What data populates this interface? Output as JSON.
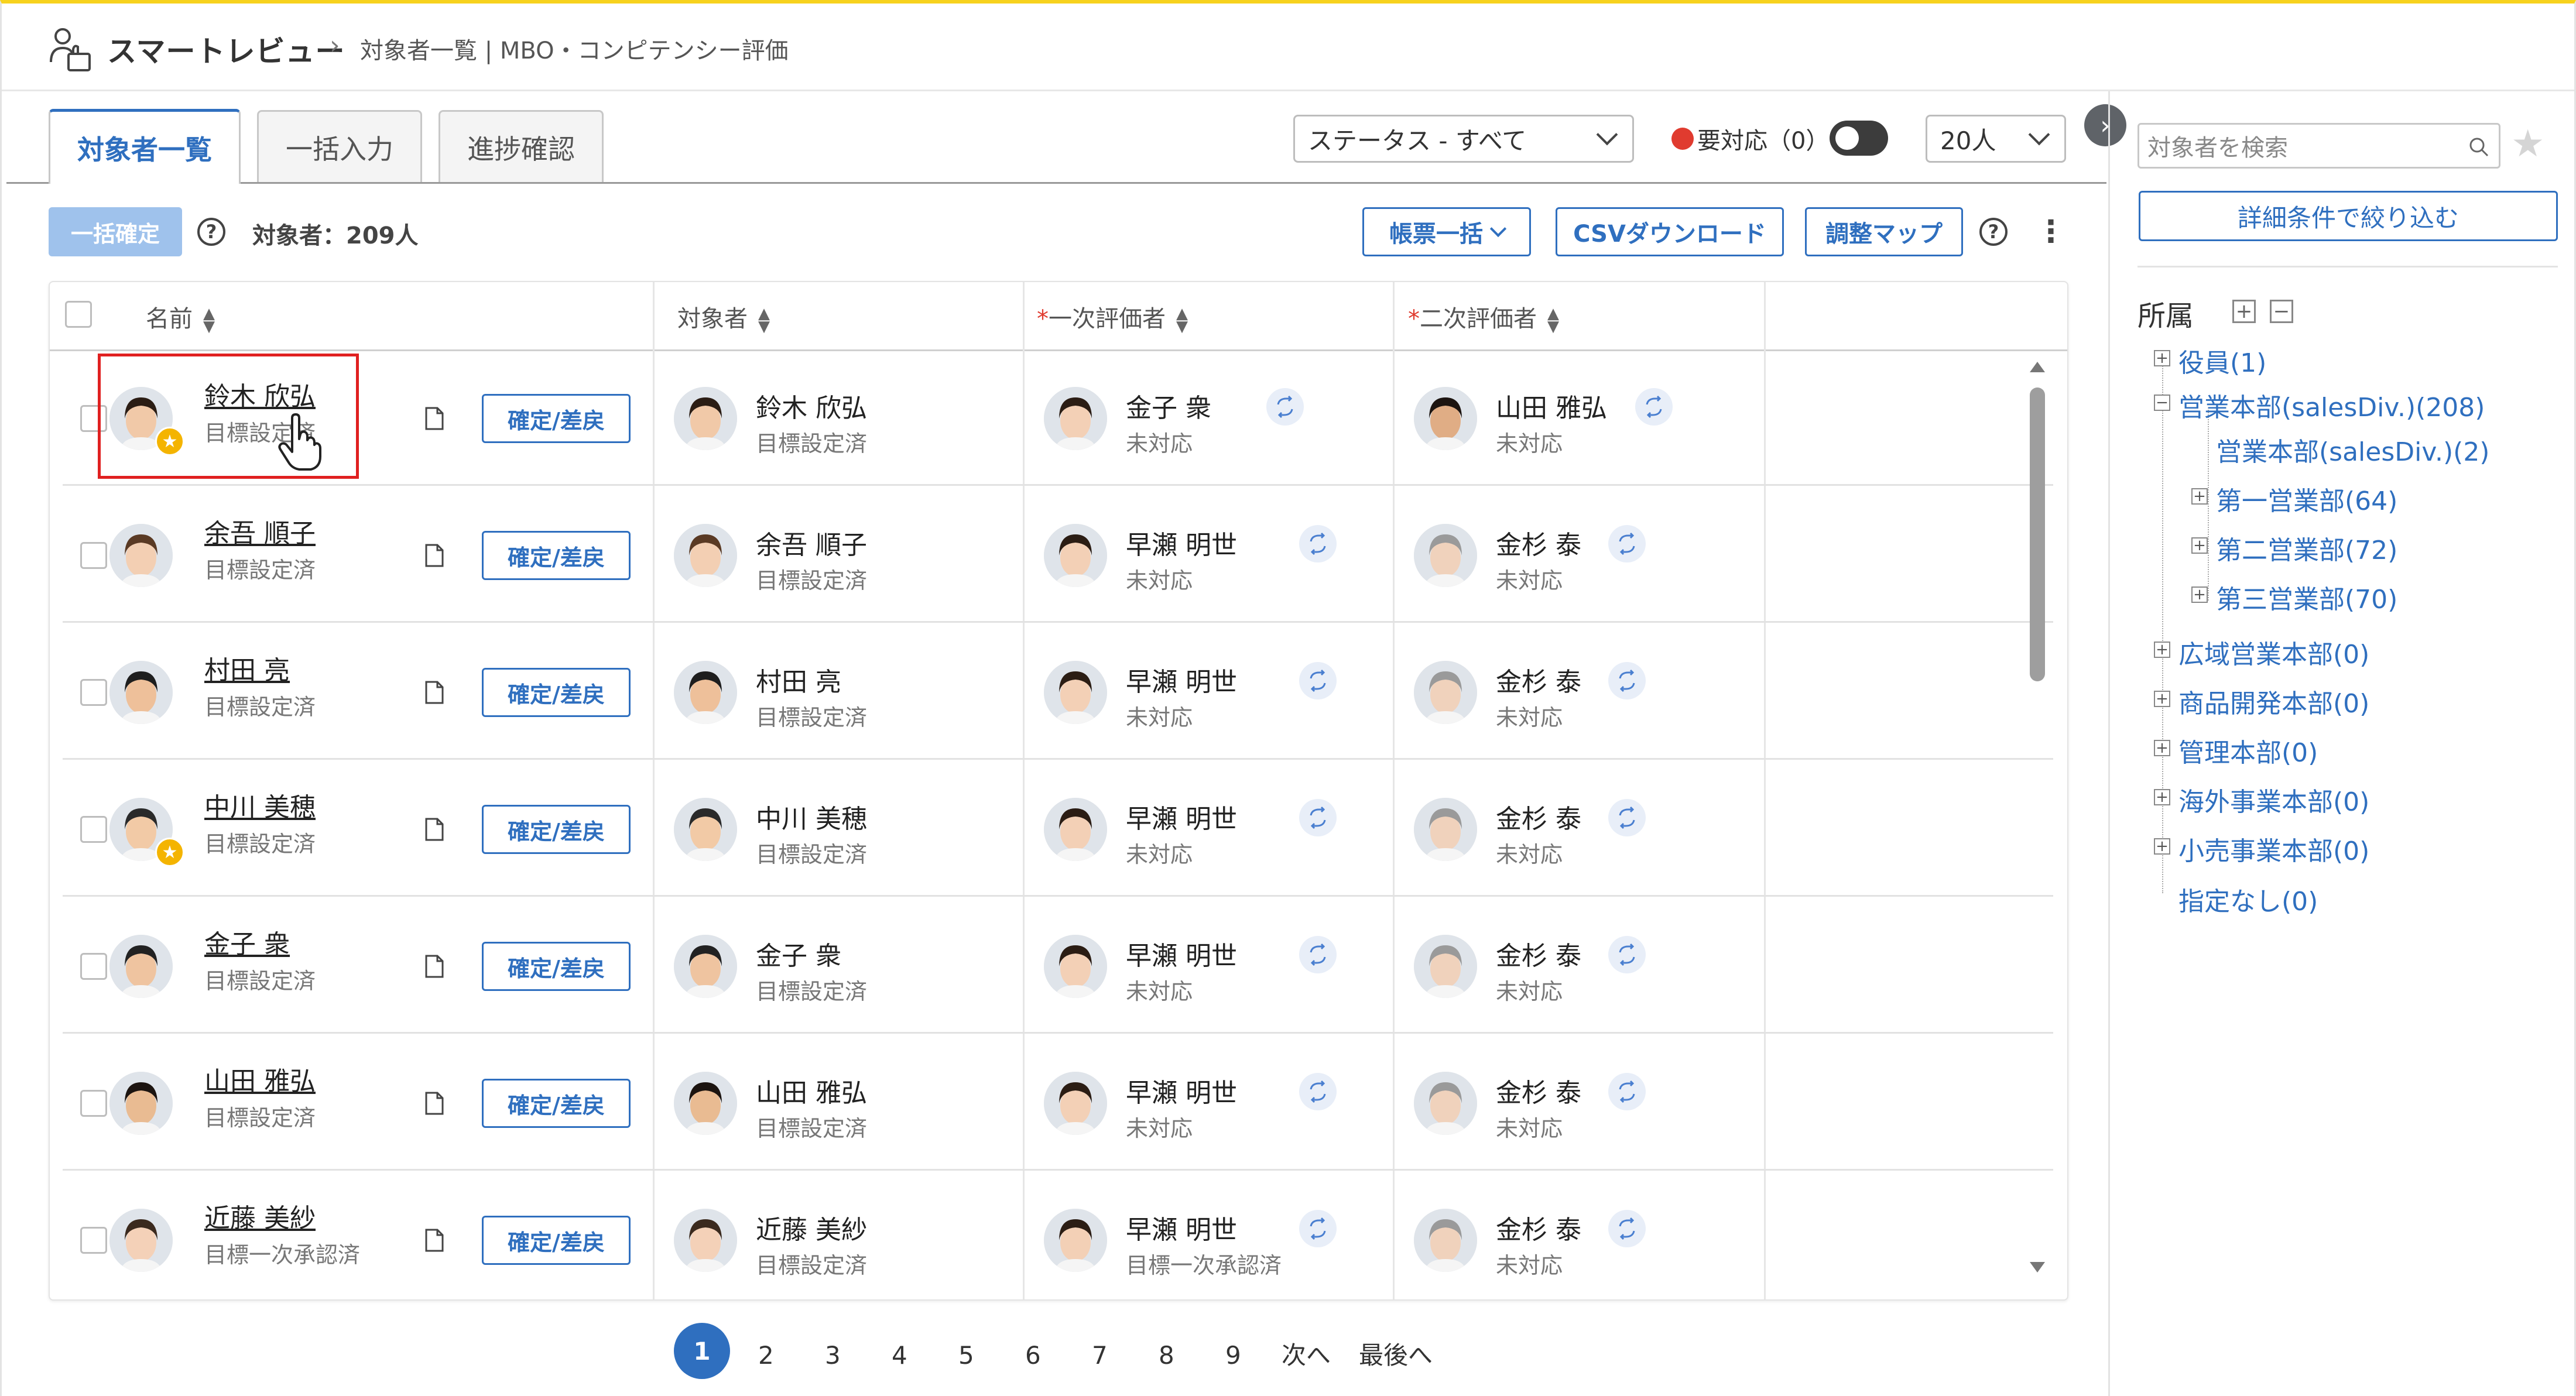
{
  "header": {
    "app_title": "スマートレビュー",
    "breadcrumb": "対象者一覧 | MBO・コンピテンシー評価"
  },
  "tabs": [
    {
      "label": "対象者一覧",
      "active": true
    },
    {
      "label": "一括入力",
      "active": false
    },
    {
      "label": "進捗確認",
      "active": false
    }
  ],
  "filters": {
    "status_select": "ステータス - すべて",
    "needs_action_label": "要対応（0）",
    "page_size_select": "20人"
  },
  "toolbar": {
    "bulk_confirm": "一括確定",
    "target_count": "対象者：209人",
    "bulk_forms": "帳票一括",
    "csv_download": "CSVダウンロード",
    "adjust_map": "調整マップ"
  },
  "table": {
    "headers": {
      "name": "名前",
      "target": "対象者",
      "first_evaluator": "一次評価者",
      "second_evaluator": "二次評価者",
      "required_mark": "*"
    },
    "confirm_label": "確定/差戻",
    "rows": [
      {
        "name": "鈴木 欣弘",
        "status": "目標設定済",
        "star": true,
        "target": "鈴木 欣弘",
        "target_status": "目標設定済",
        "first": "金子 衆",
        "first_status": "未対応",
        "second": "山田 雅弘",
        "second_status": "未対応"
      },
      {
        "name": "余吾 順子",
        "status": "目標設定済",
        "star": false,
        "target": "余吾 順子",
        "target_status": "目標設定済",
        "first": "早瀬 明世",
        "first_status": "未対応",
        "second": "金杉 泰",
        "second_status": "未対応"
      },
      {
        "name": "村田 亮",
        "status": "目標設定済",
        "star": false,
        "target": "村田 亮",
        "target_status": "目標設定済",
        "first": "早瀬 明世",
        "first_status": "未対応",
        "second": "金杉 泰",
        "second_status": "未対応"
      },
      {
        "name": "中川 美穂",
        "status": "目標設定済",
        "star": true,
        "target": "中川 美穂",
        "target_status": "目標設定済",
        "first": "早瀬 明世",
        "first_status": "未対応",
        "second": "金杉 泰",
        "second_status": "未対応"
      },
      {
        "name": "金子 衆",
        "status": "目標設定済",
        "star": false,
        "target": "金子 衆",
        "target_status": "目標設定済",
        "first": "早瀬 明世",
        "first_status": "未対応",
        "second": "金杉 泰",
        "second_status": "未対応"
      },
      {
        "name": "山田 雅弘",
        "status": "目標設定済",
        "star": false,
        "target": "山田 雅弘",
        "target_status": "目標設定済",
        "first": "早瀬 明世",
        "first_status": "未対応",
        "second": "金杉 泰",
        "second_status": "未対応"
      },
      {
        "name": "近藤 美紗",
        "status": "目標一次承認済",
        "star": false,
        "target": "近藤 美紗",
        "target_status": "目標設定済",
        "first": "早瀬 明世",
        "first_status": "目標一次承認済",
        "second": "金杉 泰",
        "second_status": "未対応"
      }
    ]
  },
  "pagination": {
    "pages": [
      "1",
      "2",
      "3",
      "4",
      "5",
      "6",
      "7",
      "8",
      "9"
    ],
    "current": "1",
    "next": "次へ",
    "last": "最後へ"
  },
  "sidebar": {
    "search_placeholder": "対象者を検索",
    "filter_button": "詳細条件で絞り込む",
    "affiliation_title": "所属",
    "tree": [
      {
        "label": "役員(1)",
        "level": 0,
        "expander": "+"
      },
      {
        "label": "営業本部(salesDiv.)(208)",
        "level": 0,
        "expander": "−"
      },
      {
        "label": "営業本部(salesDiv.)(2)",
        "level": 1,
        "expander": ""
      },
      {
        "label": "第一営業部(64)",
        "level": 1,
        "expander": "+"
      },
      {
        "label": "第二営業部(72)",
        "level": 1,
        "expander": "+"
      },
      {
        "label": "第三営業部(70)",
        "level": 1,
        "expander": "+"
      },
      {
        "label": "広域営業本部(0)",
        "level": 0,
        "expander": "+"
      },
      {
        "label": "商品開発本部(0)",
        "level": 0,
        "expander": "+"
      },
      {
        "label": "管理本部(0)",
        "level": 0,
        "expander": "+"
      },
      {
        "label": "海外事業本部(0)",
        "level": 0,
        "expander": "+"
      },
      {
        "label": "小売事業本部(0)",
        "level": 0,
        "expander": "+"
      },
      {
        "label": "指定なし(0)",
        "level": 0,
        "expander": ""
      }
    ]
  },
  "colors": {
    "accent": "#2f6fbf",
    "top_bar": "#f7d21e",
    "alert_red": "#e03b2f",
    "highlight_box": "#e02020"
  }
}
